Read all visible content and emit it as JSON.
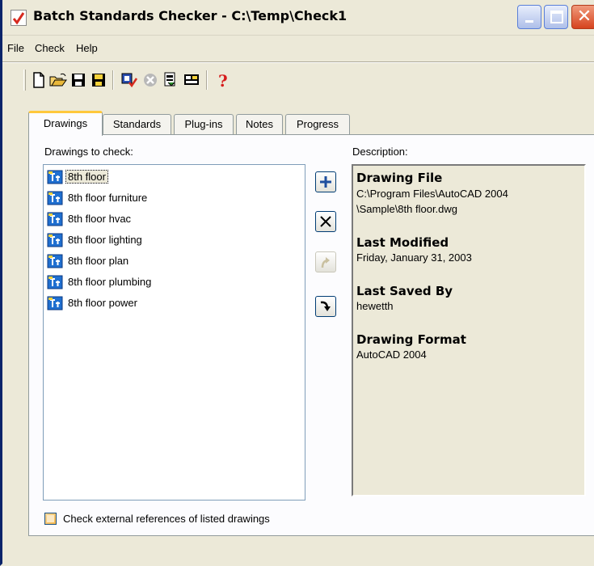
{
  "window": {
    "title": "Batch Standards Checker - C:\\Temp\\Check1",
    "controls": [
      "minimize-icon",
      "maximize-icon",
      "close-icon"
    ]
  },
  "menu": {
    "items": [
      "File",
      "Check",
      "Help"
    ]
  },
  "toolbar": {
    "buttons": [
      "new-icon",
      "open-icon",
      "save-icon",
      "save-as-icon",
      "check-icon",
      "stop-icon",
      "export-report-icon",
      "view-report-icon",
      "help-icon"
    ]
  },
  "tabs": [
    {
      "label": "Drawings",
      "active": true
    },
    {
      "label": "Standards"
    },
    {
      "label": "Plug-ins"
    },
    {
      "label": "Notes"
    },
    {
      "label": "Progress"
    }
  ],
  "drawings": {
    "label": "Drawings to check:",
    "items": [
      "8th floor",
      "8th floor furniture",
      "8th floor hvac",
      "8th floor lighting",
      "8th floor plan",
      "8th floor plumbing",
      "8th floor power"
    ],
    "selected_index": 0
  },
  "side_buttons": [
    "add-icon",
    "remove-icon",
    "move-up-icon",
    "move-down-icon"
  ],
  "description": {
    "label": "Description:",
    "drawing_file_heading": "Drawing File",
    "drawing_file_line1": "C:\\Program Files\\AutoCAD 2004",
    "drawing_file_line2": "\\Sample\\8th floor.dwg",
    "last_modified_heading": "Last Modified",
    "last_modified_value": "Friday, January 31, 2003",
    "last_saved_heading": "Last Saved By",
    "last_saved_value": "hewetth",
    "format_heading": "Drawing Format",
    "format_value": "AutoCAD 2004"
  },
  "xref_checkbox": {
    "label": "Check external references of listed drawings",
    "checked": false
  },
  "colors": {
    "window_bg": "#ece9d8",
    "tab_highlight": "#ffc83c",
    "list_icon_blue": "#1f6fd0"
  }
}
